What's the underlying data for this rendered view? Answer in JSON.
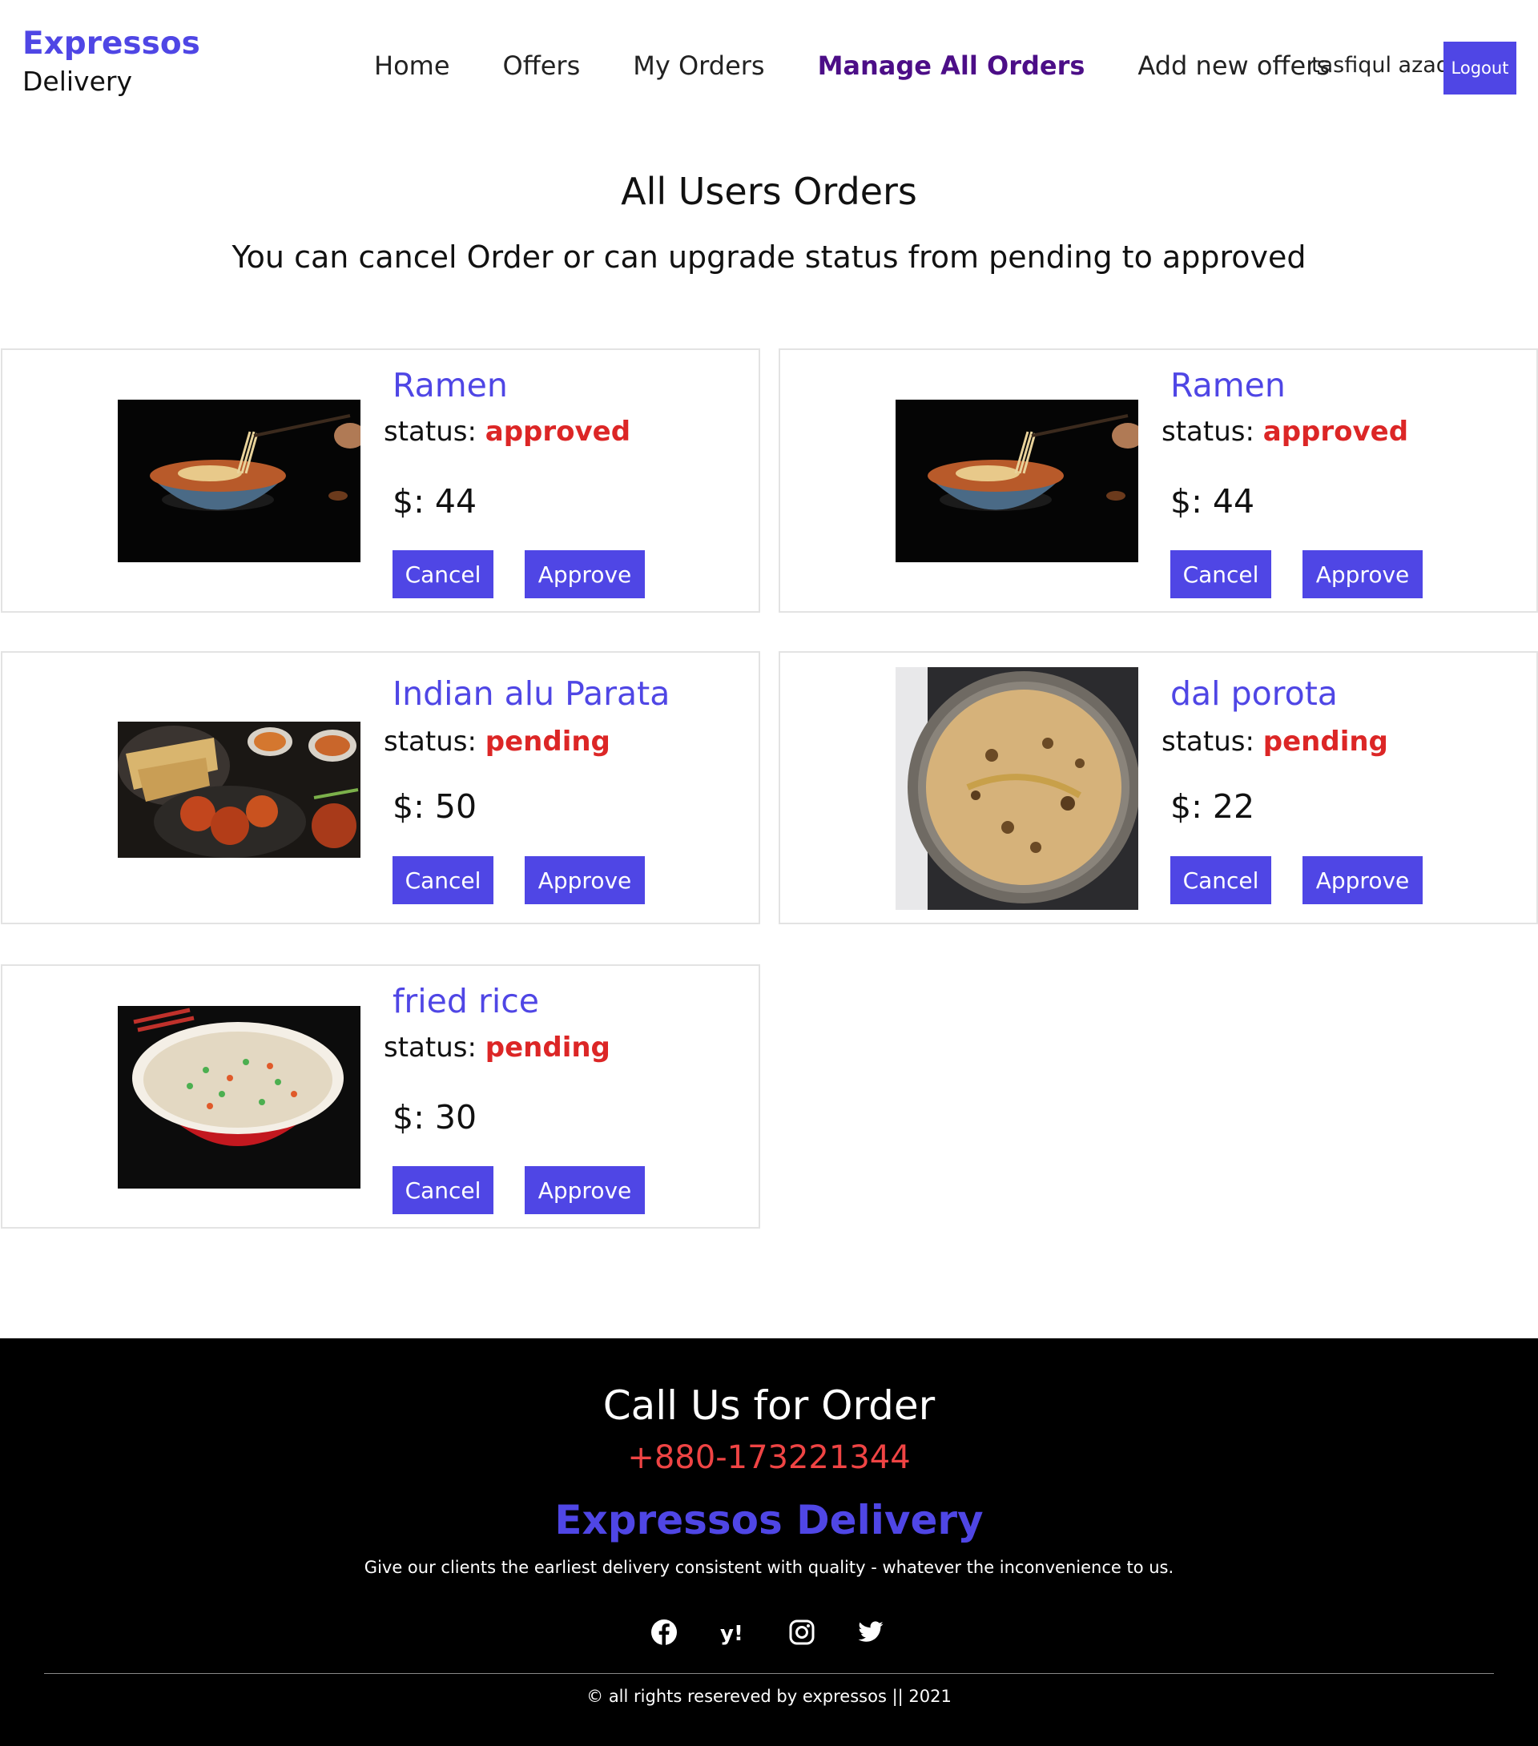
{
  "header": {
    "brand_line1": "Expressos",
    "brand_line2": "Delivery",
    "nav": [
      {
        "label": "Home"
      },
      {
        "label": "Offers"
      },
      {
        "label": "My Orders"
      },
      {
        "label": "Manage All Orders",
        "active": true
      },
      {
        "label": "Add new offers"
      }
    ],
    "user_name": "tasfiqul azad",
    "logout_label": "Logout"
  },
  "main": {
    "title": "All Users Orders",
    "subtitle": "You can cancel Order or can upgrade status from pending to approved"
  },
  "orders": [
    {
      "name": "Ramen",
      "status_label": "status:",
      "status": "approved",
      "price": "$: 44",
      "image_icon": "ramen-bowl",
      "cancel_label": "Cancel",
      "approve_label": "Approve"
    },
    {
      "name": "Ramen",
      "status_label": "status:",
      "status": "approved",
      "price": "$: 44",
      "image_icon": "ramen-bowl",
      "cancel_label": "Cancel",
      "approve_label": "Approve"
    },
    {
      "name": "Indian alu Parata",
      "status_label": "status:",
      "status": "pending",
      "price": "$: 50",
      "image_icon": "indian-platter",
      "cancel_label": "Cancel",
      "approve_label": "Approve"
    },
    {
      "name": "dal porota",
      "status_label": "status:",
      "status": "pending",
      "price": "$: 22",
      "image_icon": "paratha-plate",
      "cancel_label": "Cancel",
      "approve_label": "Approve"
    },
    {
      "name": "fried rice",
      "status_label": "status:",
      "status": "pending",
      "price": "$: 30",
      "image_icon": "fried-rice-bowl",
      "cancel_label": "Cancel",
      "approve_label": "Approve"
    }
  ],
  "footer": {
    "call_title": "Call Us for Order",
    "phone": "+880-173221344",
    "brand": "Expressos Delivery",
    "tagline": "Give our clients the earliest delivery consistent with quality - whatever the inconvenience to us.",
    "social_icons": [
      "facebook-icon",
      "yahoo-icon",
      "instagram-icon",
      "twitter-icon"
    ],
    "copyright": "© all rights resereved by expressos || 2021"
  },
  "colors": {
    "accent": "#4f46e5",
    "nav_active": "#4c0e87",
    "status": "#dc2626",
    "phone": "#ef4444",
    "footer_bg": "#000000"
  }
}
